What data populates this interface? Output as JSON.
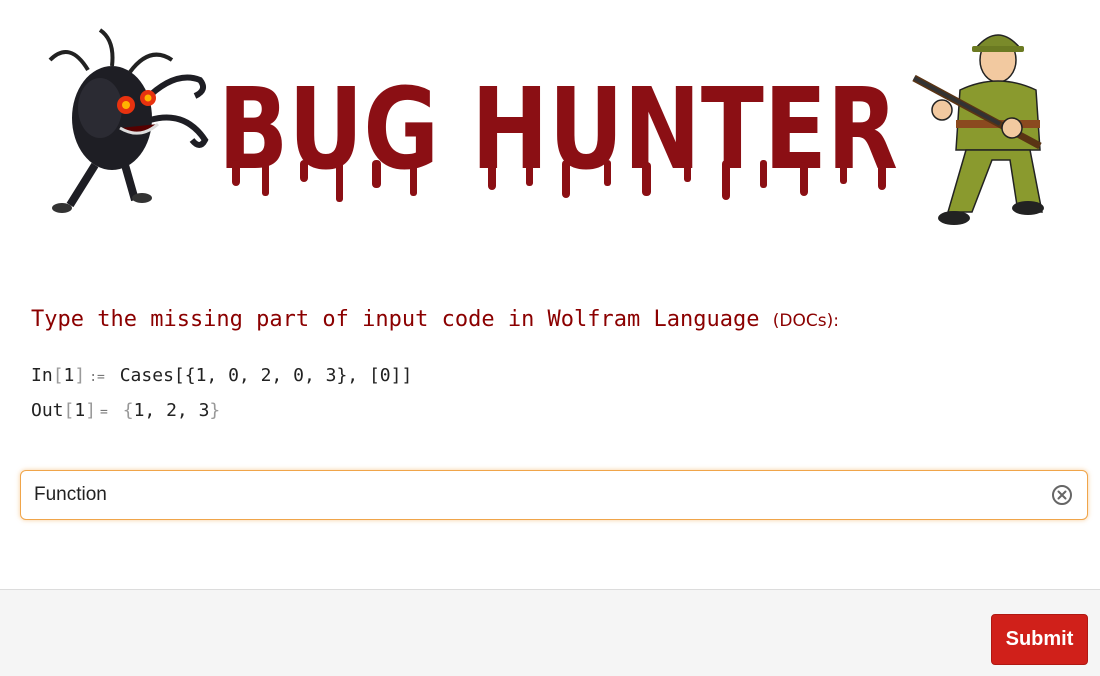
{
  "banner": {
    "title": "BUG HUNTER",
    "title_color": "#8b0f14",
    "monster_icon": "bug-monster-icon",
    "hunter_icon": "rifle-hunter-icon"
  },
  "question": {
    "prompt": "Type the missing part of input code in Wolfram Language",
    "docs_open": "(",
    "docs_link": "DOCs",
    "docs_close": "):",
    "prompt_color": "#8b0000"
  },
  "code": {
    "in_label": "In",
    "in_index": "1",
    "in_sep": ":=",
    "in_expr": "Cases[{1, 0, 2, 0, 3}, [0]]",
    "out_label": "Out",
    "out_index": "1",
    "out_sep": "=",
    "out_open": "{",
    "out_expr": "1, 2, 3",
    "out_close": "}"
  },
  "answer": {
    "value": "Function",
    "clear_icon": "clear-circle-icon",
    "border_color": "#f0a54a"
  },
  "footer": {
    "submit_label": "Submit",
    "submit_color": "#d0201a"
  }
}
